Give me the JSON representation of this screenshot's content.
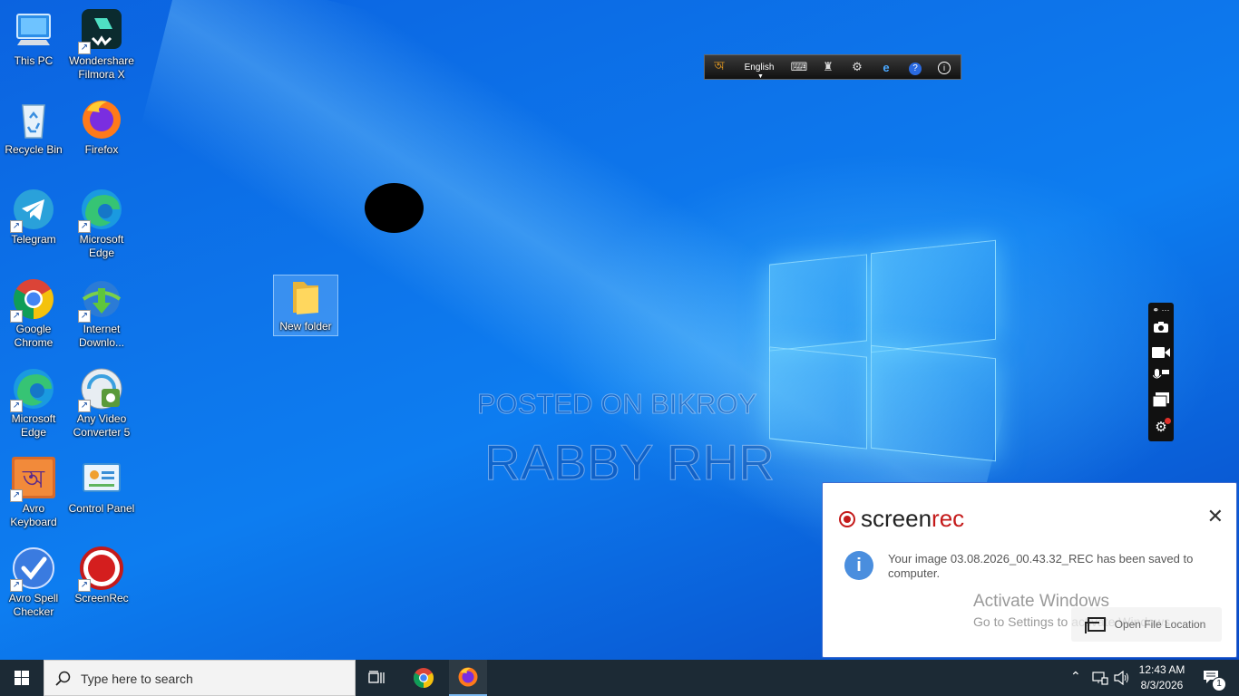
{
  "desktop": {
    "icons": [
      {
        "label": "This PC",
        "icon": "this-pc-icon"
      },
      {
        "label": "Wondershare Filmora X",
        "icon": "filmora-icon"
      },
      {
        "label": "Recycle Bin",
        "icon": "recycle-bin-icon"
      },
      {
        "label": "Firefox",
        "icon": "firefox-icon"
      },
      {
        "label": "Telegram",
        "icon": "telegram-icon"
      },
      {
        "label": "Microsoft Edge",
        "icon": "edge-icon"
      },
      {
        "label": "Google Chrome",
        "icon": "chrome-icon"
      },
      {
        "label": "Internet Downlo...",
        "icon": "idm-icon"
      },
      {
        "label": "Microsoft Edge",
        "icon": "edge-icon"
      },
      {
        "label": "Any Video Converter 5",
        "icon": "video-converter-icon"
      },
      {
        "label": "Avro Keyboard",
        "icon": "avro-icon"
      },
      {
        "label": "Control Panel",
        "icon": "control-panel-icon"
      },
      {
        "label": "Avro Spell Checker",
        "icon": "spell-check-icon"
      },
      {
        "label": "ScreenRec",
        "icon": "screenrec-icon"
      },
      {
        "label": "New folder",
        "icon": "folder-icon"
      }
    ],
    "watermark_line1": "POSTED ON BIKROY",
    "watermark_line2": "RABBY RHR"
  },
  "avro_toolbar": {
    "language": "English"
  },
  "notification": {
    "brand_prefix": "screen",
    "brand_suffix": "rec",
    "message": "Your image 03.08.2026_00.43.32_REC has been saved to computer.",
    "activate_title": "Activate Windows",
    "activate_sub": "Go to Settings to activate Windows.",
    "open_button": "Open File Location",
    "accent": "#c41a1a"
  },
  "taskbar": {
    "search_placeholder": "Type here to search",
    "time": "12:43 AM",
    "date": "8/3/2026",
    "notifications_count": "1"
  }
}
